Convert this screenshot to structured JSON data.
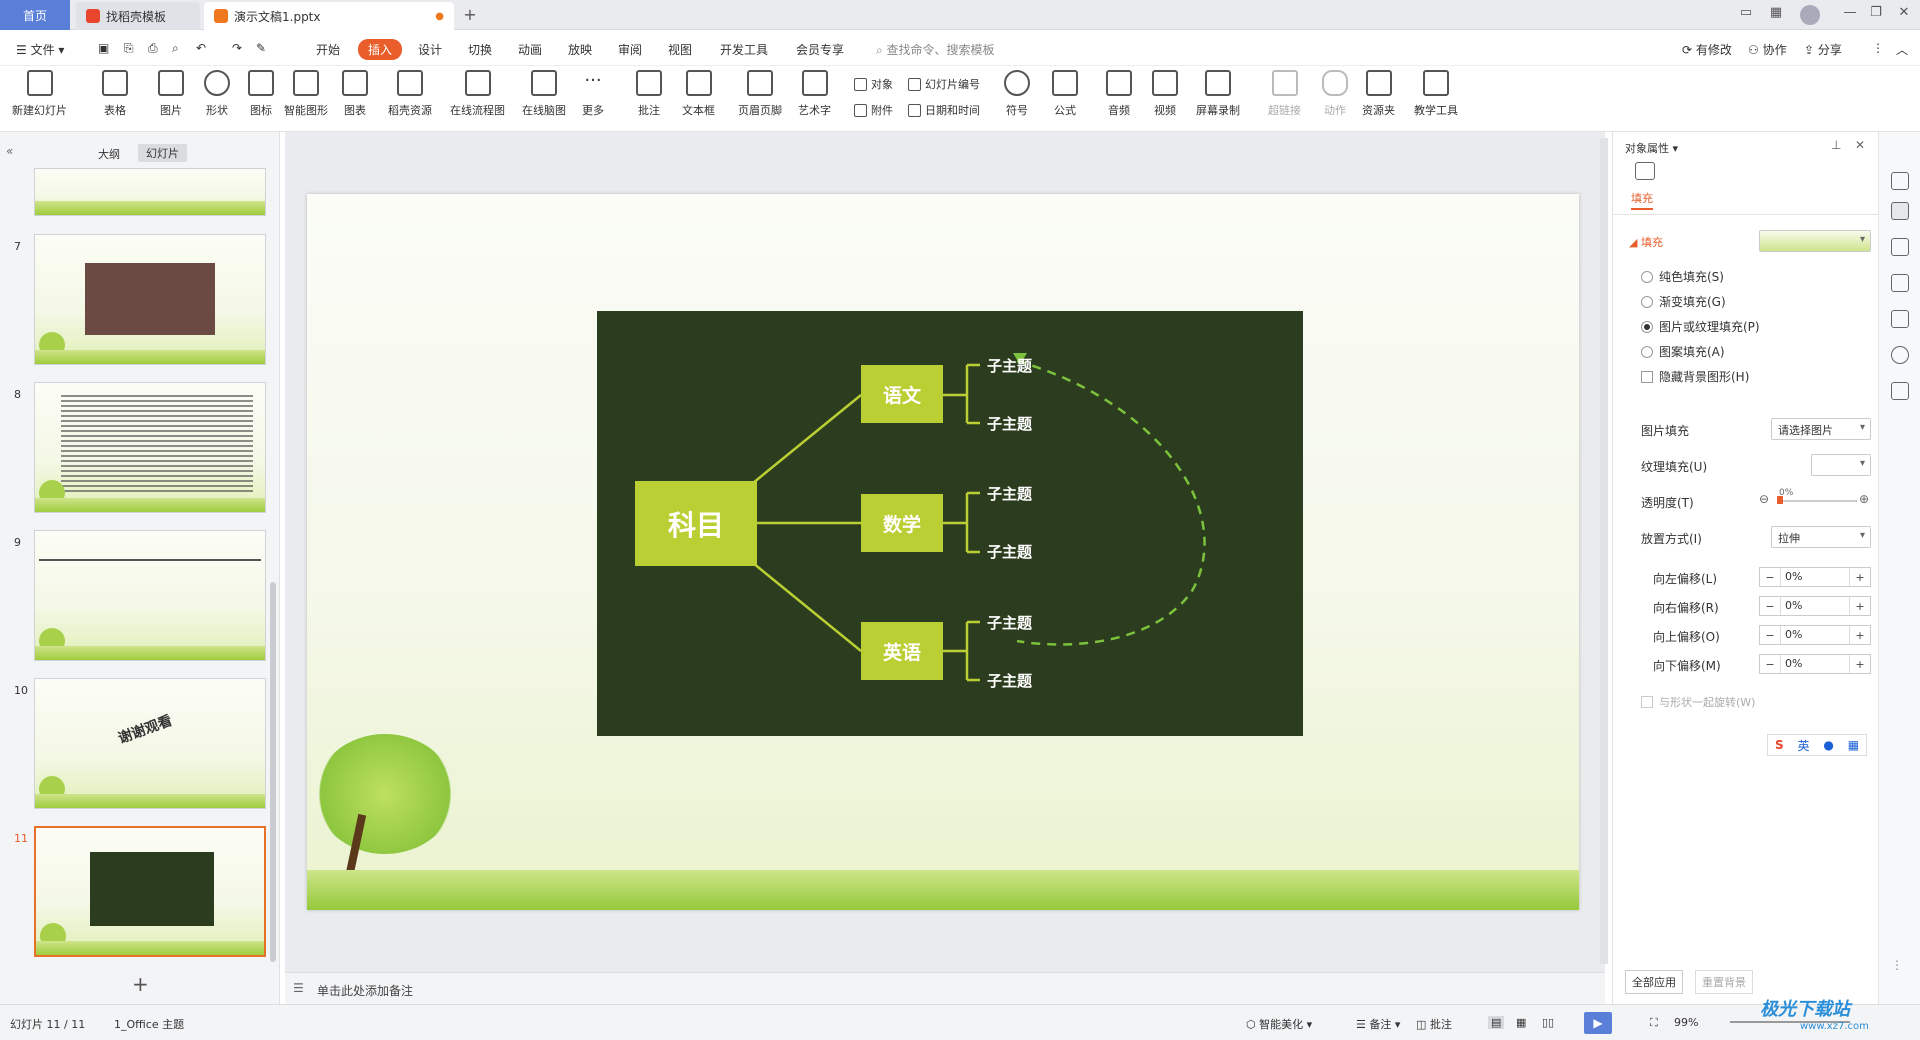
{
  "titlebar": {
    "home_tab": "首页",
    "templates_tab": "找稻壳模板",
    "doc_tab": "演示文稿1.pptx",
    "new_tab": "+"
  },
  "menu": {
    "file": "文件",
    "items": [
      "开始",
      "插入",
      "设计",
      "切换",
      "动画",
      "放映",
      "审阅",
      "视图",
      "开发工具",
      "会员专享"
    ],
    "active": "插入",
    "search_placeholder": "查找命令、搜索模板",
    "modified": "有修改",
    "collab": "协作",
    "share": "分享"
  },
  "toolbar": {
    "new_slide": "新建幻灯片",
    "table": "表格",
    "picture": "图片",
    "shape": "形状",
    "icon": "图标",
    "smartart": "智能图形",
    "chart": "图表",
    "docer": "稻壳资源",
    "flowchart": "在线流程图",
    "mindmap": "在线脑图",
    "more": "更多",
    "comment": "批注",
    "textbox": "文本框",
    "header_footer": "页眉页脚",
    "wordart": "艺术字",
    "object": "对象",
    "attachment": "附件",
    "slide_number": "幻灯片编号",
    "datetime": "日期和时间",
    "symbol": "符号",
    "formula": "公式",
    "audio": "音频",
    "video": "视频",
    "screen_record": "屏幕录制",
    "hyperlink": "超链接",
    "action": "动作",
    "resource": "资源夹",
    "teaching": "教学工具"
  },
  "leftpanel": {
    "outline_tab": "大纲",
    "slides_tab": "幻灯片",
    "slide_numbers": [
      "7",
      "8",
      "9",
      "10",
      "11"
    ],
    "slide10_text": "谢谢观看",
    "add": "+"
  },
  "slide": {
    "root": "科目",
    "branches": [
      "语文",
      "数学",
      "英语"
    ],
    "leaf": "子主题"
  },
  "notes_placeholder": "单击此处添加备注",
  "rightpanel": {
    "header": "对象属性",
    "tab_fill": "填充",
    "section_fill": "填充",
    "options": [
      "纯色填充(S)",
      "渐变填充(G)",
      "图片或纹理填充(P)",
      "图案填充(A)"
    ],
    "selected_option": "图片或纹理填充(P)",
    "hide_bg": "隐藏背景图形(H)",
    "picture_fill_label": "图片填充",
    "picture_fill_value": "请选择图片",
    "texture_fill_label": "纹理填充(U)",
    "transparency_label": "透明度(T)",
    "transparency_value": "0%",
    "placement_label": "放置方式(I)",
    "placement_value": "拉伸",
    "offsets": [
      {
        "label": "向左偏移(L)",
        "value": "0%"
      },
      {
        "label": "向右偏移(R)",
        "value": "0%"
      },
      {
        "label": "向上偏移(O)",
        "value": "0%"
      },
      {
        "label": "向下偏移(M)",
        "value": "0%"
      }
    ],
    "rotate_with_shape": "与形状一起旋转(W)",
    "apply_all": "全部应用",
    "reset_bg": "重置背景",
    "ime": "英"
  },
  "statusbar": {
    "slide_info": "幻灯片 11 / 11",
    "theme": "1_Office 主题",
    "smart_beautify": "智能美化",
    "notes": "备注",
    "comments": "批注",
    "zoom": "99%",
    "watermark": "极光下载站",
    "watermark_url": "www.xz7.com"
  }
}
